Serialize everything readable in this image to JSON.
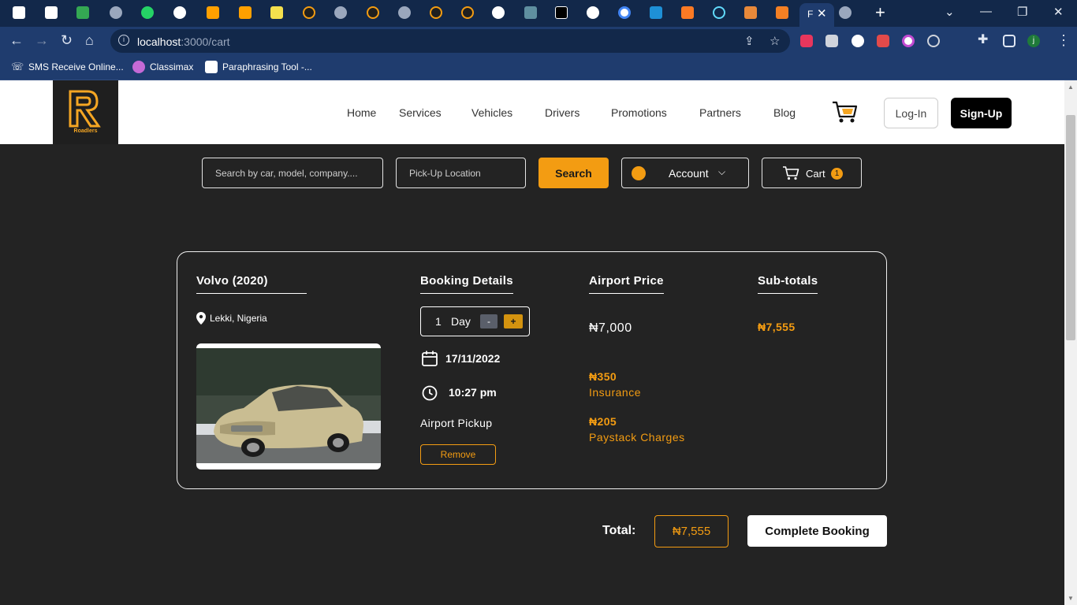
{
  "browser": {
    "active_tab_title": "F",
    "url_host": "localhost",
    "url_path": ":3000/cart",
    "bookmarks": [
      "SMS Receive Online...",
      "Classimax",
      "Paraphrasing Tool -..."
    ],
    "profile_initial": "j"
  },
  "header": {
    "logo_text": "Roadlers",
    "nav": [
      "Home",
      "Services",
      "Vehicles",
      "Drivers",
      "Promotions",
      "Partners",
      "Blog"
    ],
    "login_label": "Log-In",
    "signup_label": "Sign-Up"
  },
  "search": {
    "query_placeholder": "Search by car, model, company....",
    "location_placeholder": "Pick-Up Location",
    "search_label": "Search",
    "account_label": "Account",
    "cart_label": "Cart",
    "cart_count": "1"
  },
  "cart_item": {
    "vehicle_title": "Volvo (2020)",
    "location": "Lekki, Nigeria",
    "booking_heading": "Booking Details",
    "quantity": "1",
    "unit": "Day",
    "minus_label": "-",
    "plus_label": "+",
    "date": "17/11/2022",
    "time": "10:27 pm",
    "pickup_type": "Airport Pickup",
    "remove_label": "Remove",
    "price_heading": "Airport Price",
    "airport_price": "₦7,000",
    "insurance_amount": "₦350",
    "insurance_label": "Insurance",
    "paystack_amount": "₦205",
    "paystack_label": "Paystack Charges",
    "subtotal_heading": "Sub-totals",
    "subtotal": "₦7,555"
  },
  "summary": {
    "total_label": "Total:",
    "total_value": "₦7,555",
    "complete_label": "Complete Booking"
  },
  "colors": {
    "accent": "#f39c12",
    "page_bg": "#232323",
    "chrome_bg": "#1f3c6e"
  }
}
